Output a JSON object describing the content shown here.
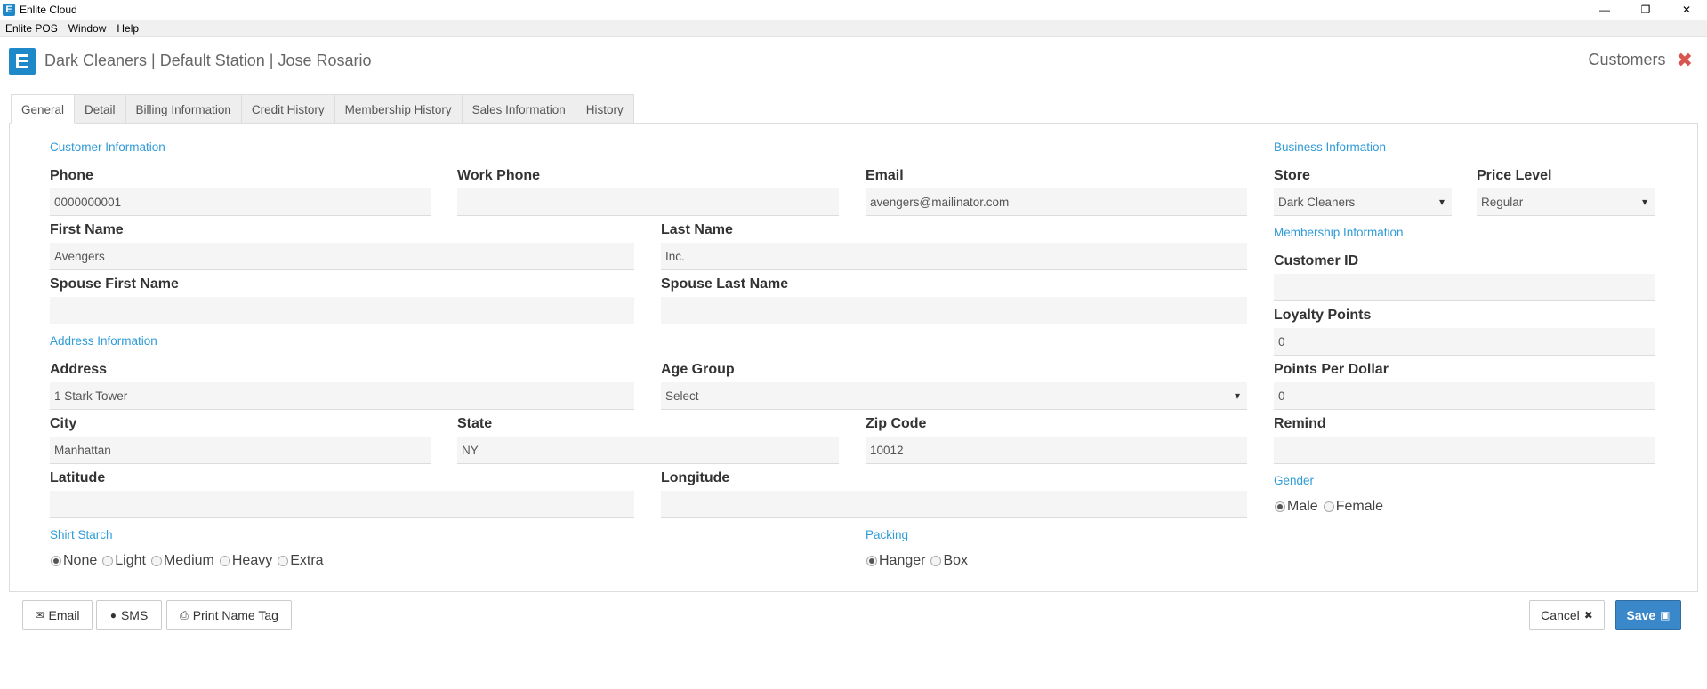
{
  "window": {
    "app_icon": "E",
    "title": "Enlite Cloud",
    "controls": {
      "minimize": "—",
      "restore": "❐",
      "close": "✕"
    }
  },
  "menu": [
    "Enlite POS",
    "Window",
    "Help"
  ],
  "header": {
    "breadcrumb": "Dark Cleaners | Default Station | Jose Rosario",
    "section": "Customers",
    "close_icon": "✖"
  },
  "tabs": [
    "General",
    "Detail",
    "Billing Information",
    "Credit History",
    "Membership History",
    "Sales Information",
    "History"
  ],
  "customer_info": {
    "title": "Customer Information",
    "phone": {
      "label": "Phone",
      "value": "0000000001"
    },
    "work_phone": {
      "label": "Work Phone",
      "value": ""
    },
    "email": {
      "label": "Email",
      "value": "avengers@mailinator.com"
    },
    "first_name": {
      "label": "First Name",
      "value": "Avengers"
    },
    "last_name": {
      "label": "Last Name",
      "value": "Inc."
    },
    "spouse_first_name": {
      "label": "Spouse First Name",
      "value": ""
    },
    "spouse_last_name": {
      "label": "Spouse Last Name",
      "value": ""
    }
  },
  "address_info": {
    "title": "Address Information",
    "address": {
      "label": "Address",
      "value": "1 Stark Tower"
    },
    "age_group": {
      "label": "Age Group",
      "value": "Select"
    },
    "city": {
      "label": "City",
      "value": "Manhattan"
    },
    "state": {
      "label": "State",
      "value": "NY"
    },
    "zip": {
      "label": "Zip Code",
      "value": "10012"
    },
    "latitude": {
      "label": "Latitude",
      "value": ""
    },
    "longitude": {
      "label": "Longitude",
      "value": ""
    }
  },
  "shirt_starch": {
    "title": "Shirt Starch",
    "options": [
      "None",
      "Light",
      "Medium",
      "Heavy",
      "Extra"
    ],
    "selected": "None"
  },
  "packing": {
    "title": "Packing",
    "options": [
      "Hanger",
      "Box"
    ],
    "selected": "Hanger"
  },
  "business_info": {
    "title": "Business Information",
    "store": {
      "label": "Store",
      "value": "Dark Cleaners"
    },
    "price_level": {
      "label": "Price Level",
      "value": "Regular"
    }
  },
  "membership_info": {
    "title": "Membership Information",
    "customer_id": {
      "label": "Customer ID",
      "value": ""
    },
    "loyalty_points": {
      "label": "Loyalty Points",
      "value": "0"
    },
    "points_per_dollar": {
      "label": "Points Per Dollar",
      "value": "0"
    },
    "remind": {
      "label": "Remind",
      "value": ""
    }
  },
  "gender": {
    "title": "Gender",
    "options": [
      "Male",
      "Female"
    ],
    "selected": "Male"
  },
  "footer": {
    "email": "Email",
    "sms": "SMS",
    "print_name_tag": "Print Name Tag",
    "cancel": "Cancel",
    "save": "Save"
  }
}
